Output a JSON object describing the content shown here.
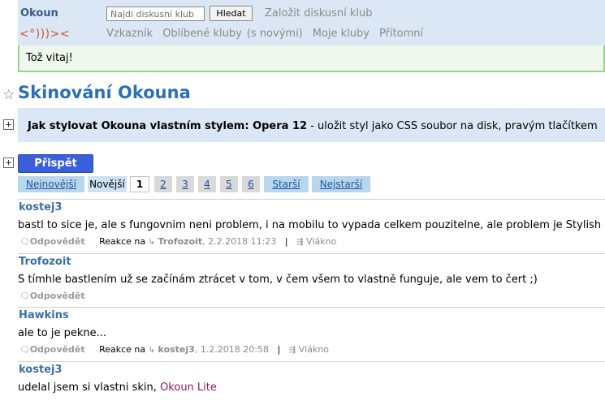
{
  "header": {
    "brand": "Okoun",
    "fish_logo": "<°)))><",
    "search_placeholder": "Najdi diskusní klub",
    "search_button": "Hledat",
    "create_club": "Založit diskusní klub",
    "nav": [
      "Vzkazník",
      "Oblíbené kluby",
      "(s novými)",
      "Moje kluby",
      "Přítomní"
    ]
  },
  "welcome": "Tož vitaj!",
  "title": "Skinování Okouna",
  "description": {
    "bold": "Jak stylovat Okouna vlastním stylem: Opera 12",
    "rest": " - uložit styl jako CSS soubor na disk, pravým tlačítkem"
  },
  "post_button": "Přispět",
  "pager": {
    "newest": "Nejnovější",
    "newer": "Novější",
    "pages": [
      "1",
      "2",
      "3",
      "4",
      "5",
      "6"
    ],
    "older": "Starší",
    "oldest": "Nejstarší"
  },
  "posts": [
    {
      "author": "kostej3",
      "text": "bastl to sice je, ale s fungovnim neni problem, i na mobilu to vypada celkem pouzitelne, ale problem je Stylish",
      "reply": "Odpovědět",
      "reaction_label": "Reakce na",
      "reaction_to": "Trofozoit",
      "reaction_time": ", 2.2.2018 11:23",
      "thread": "Vlákno"
    },
    {
      "author": "Trofozoit",
      "text": "S tímhle bastlením už se začínám ztrácet v tom, v čem všem to vlastně funguje, ale vem to čert ;)",
      "reply": "Odpovědět"
    },
    {
      "author": "Hawkins",
      "text": "ale to je pekne...",
      "reply": "Odpovědět",
      "reaction_label": "Reakce na",
      "reaction_to": "kostej3",
      "reaction_time": ", 1.2.2018 20:58",
      "thread": "Vlákno"
    },
    {
      "author": "kostej3",
      "text": "udelal jsem si vlastni skin, ",
      "link": "Okoun Lite"
    }
  ],
  "icons": {
    "star": "star-icon",
    "plus": "plus-icon",
    "reply": "speech-bubble-icon",
    "reaction": "reply-arrow-icon",
    "thread": "thread-icon"
  },
  "colors": {
    "header_bg": "#dbe7f5",
    "title": "#2c6fb5",
    "author": "#3c6fa6",
    "post_button": "#3b5fd9",
    "welcome_border": "#9fce93",
    "fish": "#d2552a"
  }
}
